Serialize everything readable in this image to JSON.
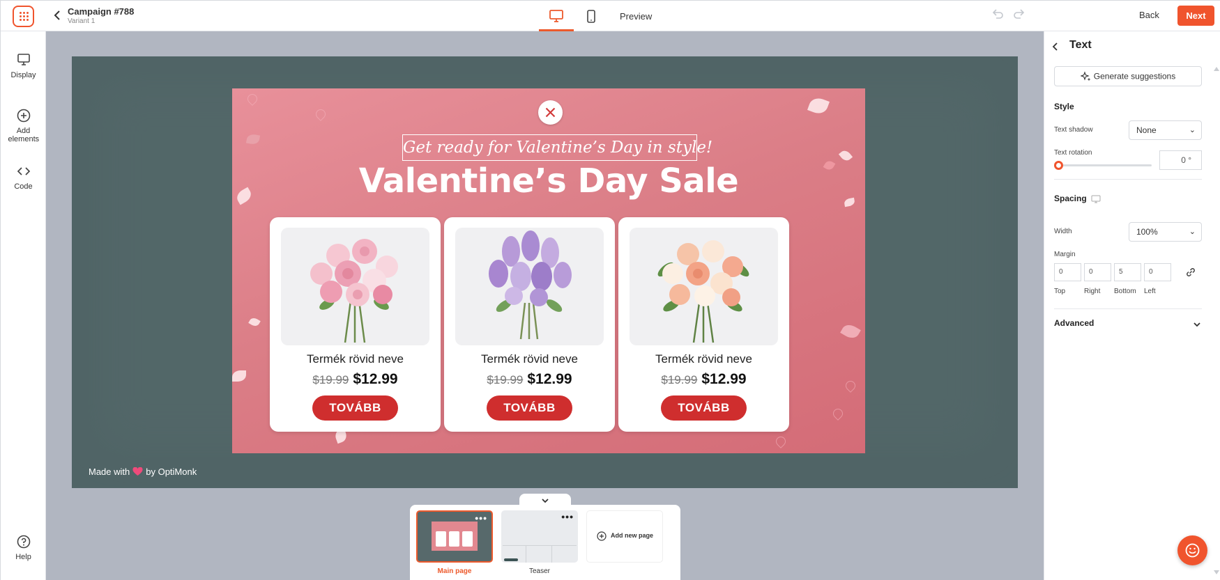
{
  "topbar": {
    "campaign_title": "Campaign #788",
    "variant": "Variant 1",
    "preview_label": "Preview",
    "back_label": "Back",
    "next_label": "Next",
    "accent_color": "#f0542d"
  },
  "sidebar": {
    "items": [
      {
        "label": "Display",
        "icon": "monitor-icon"
      },
      {
        "label": "Add elements",
        "icon": "plus-circle-icon"
      },
      {
        "label": "Code",
        "icon": "code-icon"
      }
    ],
    "help_label": "Help"
  },
  "popup": {
    "headline": "Get ready for Valentine’s Day in style!",
    "title": "Valentine’s Day Sale",
    "products": [
      {
        "name": "Termék rövid neve",
        "old_price": "$19.99",
        "price": "$12.99",
        "button": "TOVÁBB",
        "image": "pink-roses-bouquet"
      },
      {
        "name": "Termék rövid neve",
        "old_price": "$19.99",
        "price": "$12.99",
        "button": "TOVÁBB",
        "image": "lilac-bouquet"
      },
      {
        "name": "Termék rövid neve",
        "old_price": "$19.99",
        "price": "$12.99",
        "button": "TOVÁBB",
        "image": "peach-roses-bouquet"
      }
    ],
    "made_with_prefix": "Made with",
    "made_with_suffix": "by OptiMonk"
  },
  "pages": {
    "items": [
      {
        "label": "Main page",
        "active": true
      },
      {
        "label": "Teaser",
        "active": false
      }
    ],
    "add_label": "Add new page"
  },
  "panel": {
    "title": "Text",
    "generate_label": "Generate suggestions",
    "style_heading": "Style",
    "text_shadow_label": "Text shadow",
    "text_shadow_value": "None",
    "text_rotation_label": "Text rotation",
    "text_rotation_value": "0 °",
    "spacing_heading": "Spacing",
    "width_label": "Width",
    "width_value": "100%",
    "margin_label": "Margin",
    "margin": {
      "top": "0",
      "right": "0",
      "bottom": "5",
      "left": "0",
      "top_label": "Top",
      "right_label": "Right",
      "bottom_label": "Bottom",
      "left_label": "Left"
    },
    "advanced_heading": "Advanced"
  }
}
